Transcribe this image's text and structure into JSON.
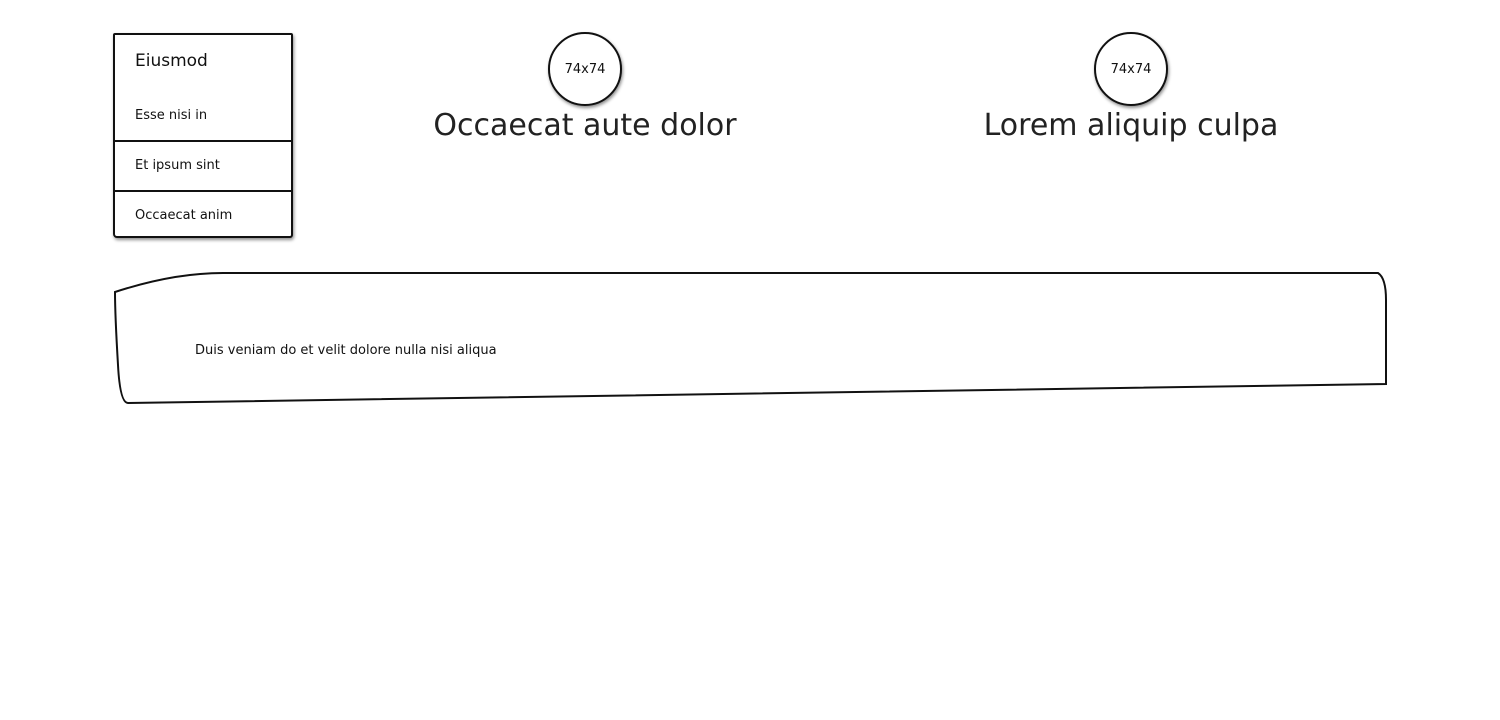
{
  "menu": {
    "header": "Eiusmod",
    "items": [
      {
        "label": "Esse nisi in"
      },
      {
        "label": "Et ipsum sint"
      },
      {
        "label": "Occaecat anim"
      }
    ]
  },
  "profiles": [
    {
      "avatar_label": "74x74",
      "title": "Occaecat aute dolor"
    },
    {
      "avatar_label": "74x74",
      "title": "Lorem aliquip culpa"
    }
  ],
  "note": {
    "text": "Duis veniam do et velit dolore nulla nisi aliqua"
  }
}
